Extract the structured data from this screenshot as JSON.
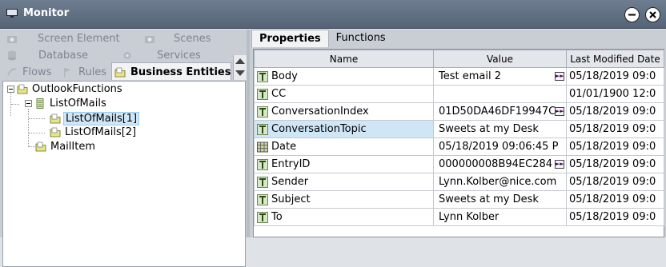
{
  "window": {
    "title": "Monitor"
  },
  "left_nav": {
    "row1": [
      "Screen Element",
      "Scenes"
    ],
    "row2": [
      "Database",
      "Services"
    ],
    "row3": [
      "Flows",
      "Rules",
      "Business Entities"
    ]
  },
  "tree": {
    "root": "OutlookFunctions",
    "child": "ListOfMails",
    "items": [
      "ListOfMails[1]",
      "ListOfMails[2]"
    ],
    "sibling": "MailItem"
  },
  "right_tabs": [
    "Properties",
    "Functions"
  ],
  "table": {
    "headers": [
      "Name",
      "Value",
      "Last Modified Date"
    ],
    "rows": [
      {
        "name": "Body",
        "value": "Test email 2",
        "date": "05/18/2019 09:0",
        "icon": "text-icon",
        "more": true
      },
      {
        "name": "CC",
        "value": "",
        "date": "01/01/1900 12:0",
        "icon": "text-icon",
        "more": false
      },
      {
        "name": "ConversationIndex",
        "value": "01D50DA46DF19947C",
        "date": "05/18/2019 09:0",
        "icon": "text-icon",
        "more": true
      },
      {
        "name": "ConversationTopic",
        "value": "Sweets at my Desk",
        "date": "05/18/2019 09:0",
        "icon": "text-icon",
        "more": false
      },
      {
        "name": "Date",
        "value": "05/18/2019 09:06:45 P",
        "date": "05/18/2019 09:0",
        "icon": "calendar-icon",
        "more": false
      },
      {
        "name": "EntryID",
        "value": "000000008B94EC284",
        "date": "05/18/2019 09:0",
        "icon": "text-icon",
        "more": true
      },
      {
        "name": "Sender",
        "value": "Lynn.Kolber@nice.com",
        "date": "05/18/2019 09:0",
        "icon": "text-icon",
        "more": false
      },
      {
        "name": "Subject",
        "value": "Sweets at my Desk",
        "date": "05/18/2019 09:0",
        "icon": "text-icon",
        "more": false
      },
      {
        "name": "To",
        "value": "Lynn Kolber",
        "date": "05/18/2019 09:0",
        "icon": "text-icon",
        "more": false
      }
    ]
  },
  "colors": {
    "titlebar": "#5f6d82",
    "selection": "#cfe6f7",
    "pane_bg": "#c9ced5"
  }
}
